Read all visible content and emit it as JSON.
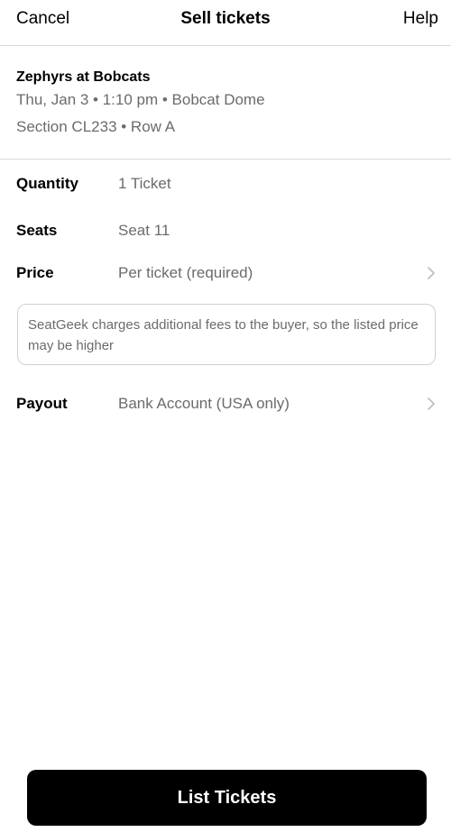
{
  "nav": {
    "cancel_label": "Cancel",
    "title": "Sell tickets",
    "help_label": "Help"
  },
  "event": {
    "name": "Zephyrs at Bobcats",
    "datetime": "Thu, Jan 3 • 1:10 pm • Bobcat Dome",
    "seating": "Section CL233 • Row A"
  },
  "form": {
    "quantity": {
      "label": "Quantity",
      "value": "1 Ticket"
    },
    "seats": {
      "label": "Seats",
      "value": "Seat 11"
    },
    "price": {
      "label": "Price",
      "value": "Per ticket (required)",
      "icon": "chevron-right-icon"
    },
    "fee_note": "SeatGeek charges additional fees to the buyer, so the listed price may be higher",
    "payout": {
      "label": "Payout",
      "value": "Bank Account (USA only)",
      "icon": "chevron-right-icon"
    }
  },
  "footer": {
    "list_button_label": "List Tickets"
  },
  "colors": {
    "primary_text": "#000000",
    "secondary_text": "#6b6b6b",
    "divider": "#d9d9d9",
    "button_bg": "#000000",
    "button_text": "#ffffff"
  }
}
